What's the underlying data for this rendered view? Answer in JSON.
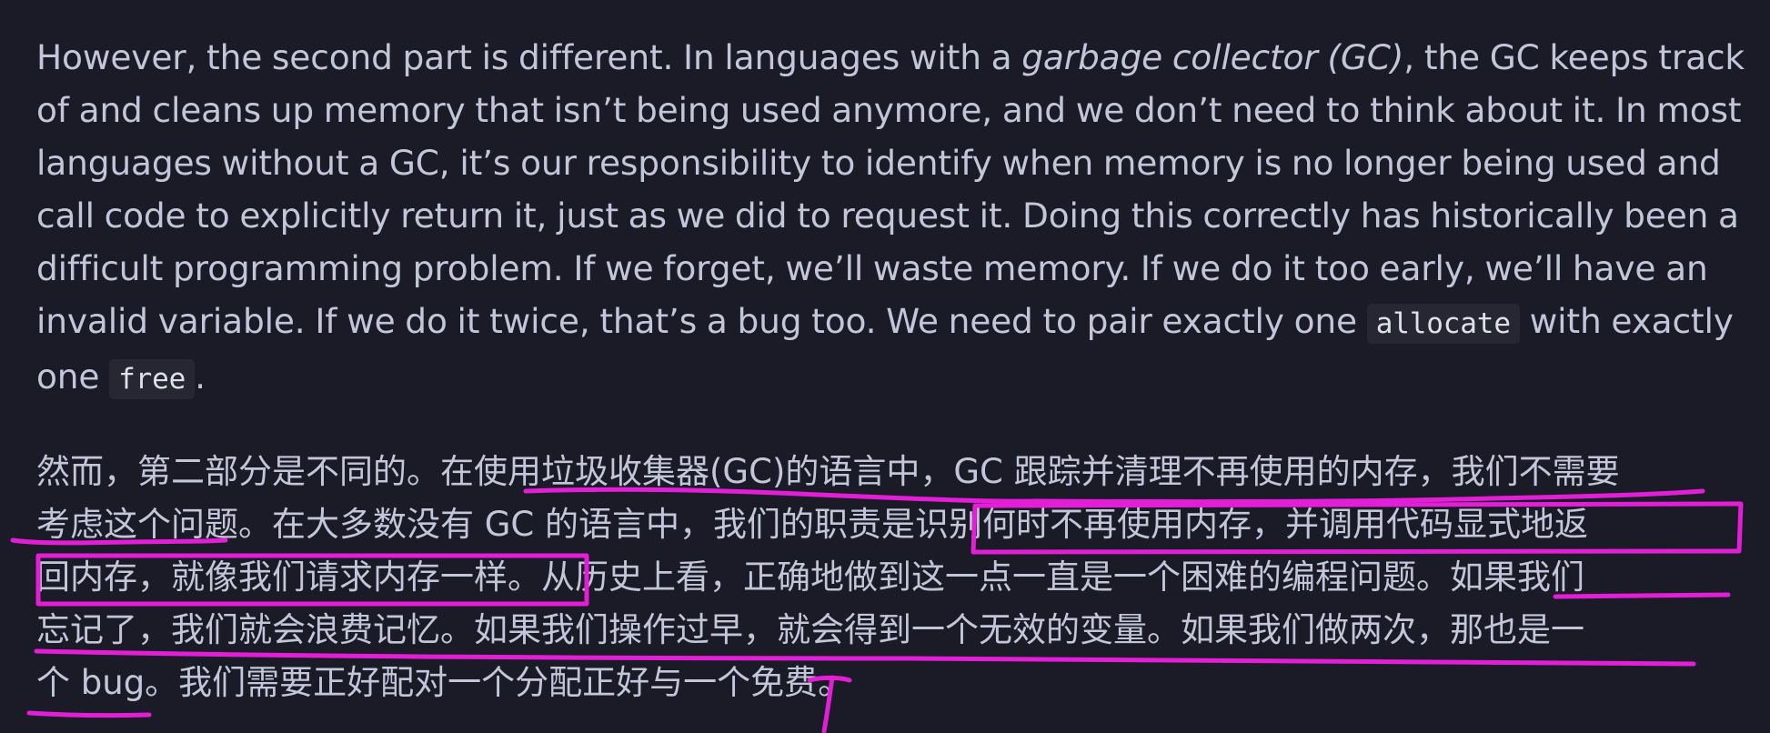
{
  "english_paragraph": {
    "line1_pre": "However, the second part is different. In languages with a ",
    "line1_italic": "garbage collector (GC)",
    "line1_post": ", the GC keeps track",
    "line2": "of and cleans up memory that isn’t being used anymore, and we don’t need to think about it. In most",
    "line3": "languages without a GC, it’s our responsibility to identify when memory is no longer being used and",
    "line4": "call code to explicitly return it, just as we did to request it. Doing this correctly has historically been a",
    "line5": "difficult programming problem. If we forget, we’ll waste memory. If we do it too early, we’ll have an",
    "line6_pre": "invalid variable. If we do it twice, that’s a bug too. We need to pair exactly one ",
    "line6_code": "allocate",
    "line6_post": " with exactly",
    "line7_pre": "one ",
    "line7_code": "free",
    "line7_post": "."
  },
  "chinese_paragraph": {
    "line1": "然而，第二部分是不同的。在使用垃圾收集器(GC)的语言中，GC 跟踪并清理不再使用的内存，我们不需要",
    "line2": "考虑这个问题。在大多数没有 GC 的语言中，我们的职责是识别何时不再使用内存，并调用代码显式地返",
    "line3": "回内存，就像我们请求内存一样。从历史上看，正确地做到这一点一直是一个困难的编程问题。如果我们",
    "line4": "忘记了，我们就会浪费记忆。如果我们操作过早，就会得到一个无效的变量。如果我们做两次，那也是一",
    "line5": "个 bug。我们需要正好配对一个分配正好与一个免费。"
  },
  "colors": {
    "background": "#1a1b26",
    "text": "#c3c6d8",
    "annotation": "#e21fd6",
    "code_background": "#262733"
  }
}
